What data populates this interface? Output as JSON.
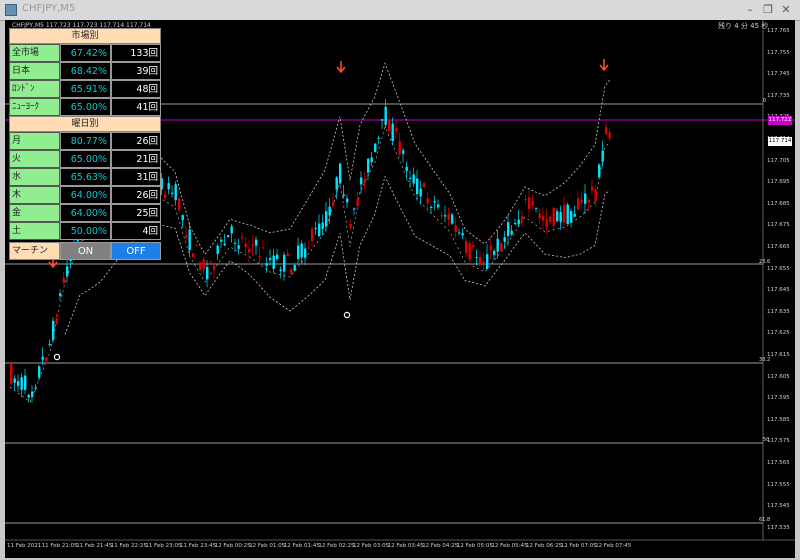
{
  "window": {
    "title": "CHFJPY,M5"
  },
  "chart": {
    "symbol_line": "CHFJPY,M5  117.723 117.723 117.714 117.714",
    "timer": "残り 4 分 45 秒",
    "current_price": "117.714",
    "line_price": "117.722",
    "price_axis": [
      "117.765",
      "117.755",
      "117.745",
      "117.735",
      "117.725",
      "117.714",
      "117.705",
      "117.695",
      "117.685",
      "117.675",
      "117.665",
      "117.655",
      "117.645",
      "117.635",
      "117.625",
      "117.615",
      "117.605",
      "117.595",
      "117.585",
      "117.575",
      "117.565",
      "117.555",
      "117.545",
      "117.535"
    ],
    "time_axis": [
      "11 Feb 2021",
      "11 Feb 21:05",
      "11 Feb 21:45",
      "11 Feb 22:25",
      "11 Feb 23:05",
      "11 Feb 23:45",
      "12 Feb 00:25",
      "12 Feb 01:05",
      "12 Feb 01:45",
      "12 Feb 02:25",
      "12 Feb 03:05",
      "12 Feb 03:45",
      "12 Feb 04:25",
      "12 Feb 05:05",
      "12 Feb 05:45",
      "12 Feb 06:25",
      "12 Feb 07:05",
      "12 Feb 07:45"
    ],
    "fib_levels": [
      "0",
      "23.6",
      "38.2",
      "50",
      "61.8"
    ],
    "colors": {
      "bull": "#00e5ff",
      "bear": "#e00000",
      "signal_arrow": "#ff4a2a",
      "magenta_line": "#cc00cc",
      "band": "#c8c8c8"
    }
  },
  "stats_panel": {
    "market_header": "市場別",
    "markets": [
      {
        "name": "全市場",
        "rate": "67.42%",
        "count": "133回"
      },
      {
        "name": "日本",
        "rate": "68.42%",
        "count": "39回"
      },
      {
        "name": "ﾛﾝﾄﾞﾝ",
        "rate": "65.91%",
        "count": "48回"
      },
      {
        "name": "ﾆｭｰﾖｰｸ",
        "rate": "65.00%",
        "count": "41回"
      }
    ],
    "weekday_header": "曜日別",
    "weekdays": [
      {
        "name": "月",
        "rate": "80.77%",
        "count": "26回"
      },
      {
        "name": "火",
        "rate": "65.00%",
        "count": "21回"
      },
      {
        "name": "水",
        "rate": "65.63%",
        "count": "31回"
      },
      {
        "name": "木",
        "rate": "64.00%",
        "count": "26回"
      },
      {
        "name": "金",
        "rate": "64.00%",
        "count": "25回"
      },
      {
        "name": "土",
        "rate": "50.00%",
        "count": "4回"
      }
    ],
    "martingale_label": "マーチン",
    "on_label": "ON",
    "off_label": "OFF"
  }
}
